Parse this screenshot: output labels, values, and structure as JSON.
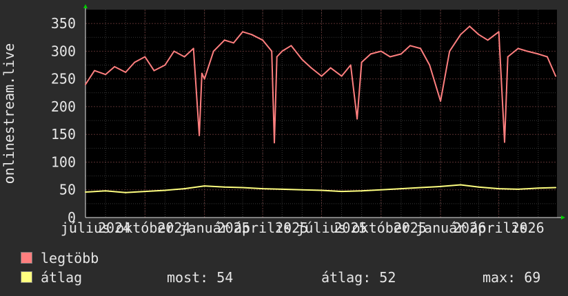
{
  "chart_data": {
    "type": "line",
    "ylabel": "onlinestream.live",
    "ylim": [
      0,
      375
    ],
    "yticks": [
      0,
      50,
      100,
      150,
      200,
      250,
      300,
      350
    ],
    "xlim": [
      "2024-07-01",
      "2026-06-30"
    ],
    "xticks": [
      {
        "month": "július",
        "year": "2024"
      },
      {
        "month": "október",
        "year": "2024"
      },
      {
        "month": "január",
        "year": "2025"
      },
      {
        "month": "április",
        "year": "2025"
      },
      {
        "month": "július",
        "year": "2025"
      },
      {
        "month": "október",
        "year": "2025"
      },
      {
        "month": "január",
        "year": "2026"
      },
      {
        "month": "április",
        "year": "2026"
      }
    ],
    "grid": true,
    "legend_placement": "bottom",
    "series": [
      {
        "name": "legtöbb",
        "color": "#ff7f7f",
        "x": [
          "2024-07-01",
          "2024-07-15",
          "2024-08-01",
          "2024-08-15",
          "2024-09-01",
          "2024-09-15",
          "2024-10-01",
          "2024-10-15",
          "2024-11-01",
          "2024-11-15",
          "2024-12-01",
          "2024-12-15",
          "2024-12-24",
          "2024-12-28",
          "2025-01-01",
          "2025-01-15",
          "2025-02-01",
          "2025-02-15",
          "2025-03-01",
          "2025-03-15",
          "2025-04-01",
          "2025-04-15",
          "2025-04-19",
          "2025-04-23",
          "2025-05-01",
          "2025-05-15",
          "2025-06-01",
          "2025-06-15",
          "2025-07-01",
          "2025-07-15",
          "2025-08-01",
          "2025-08-15",
          "2025-08-25",
          "2025-09-01",
          "2025-09-15",
          "2025-10-01",
          "2025-10-15",
          "2025-11-01",
          "2025-11-15",
          "2025-12-01",
          "2025-12-15",
          "2026-01-01",
          "2026-01-15",
          "2026-02-01",
          "2026-02-15",
          "2026-03-01",
          "2026-03-15",
          "2026-04-01",
          "2026-04-10",
          "2026-04-15",
          "2026-05-01",
          "2026-05-15",
          "2026-06-01",
          "2026-06-15",
          "2026-06-28"
        ],
        "values": [
          240,
          265,
          258,
          272,
          262,
          280,
          290,
          265,
          275,
          300,
          290,
          305,
          148,
          260,
          250,
          300,
          320,
          315,
          335,
          330,
          320,
          300,
          135,
          290,
          300,
          310,
          285,
          270,
          255,
          270,
          255,
          275,
          178,
          280,
          295,
          300,
          290,
          295,
          310,
          305,
          275,
          210,
          300,
          330,
          345,
          330,
          320,
          335,
          136,
          290,
          305,
          300,
          295,
          290,
          255
        ]
      },
      {
        "name": "átlag",
        "color": "#ffff80",
        "x": [
          "2024-07-01",
          "2024-08-01",
          "2024-09-01",
          "2024-10-01",
          "2024-11-01",
          "2024-12-01",
          "2025-01-01",
          "2025-02-01",
          "2025-03-01",
          "2025-04-01",
          "2025-05-01",
          "2025-06-01",
          "2025-07-01",
          "2025-08-01",
          "2025-09-01",
          "2025-10-01",
          "2025-11-01",
          "2025-12-01",
          "2026-01-01",
          "2026-02-01",
          "2026-03-01",
          "2026-04-01",
          "2026-05-01",
          "2026-06-01",
          "2026-06-28"
        ],
        "values": [
          46,
          48,
          45,
          47,
          49,
          52,
          57,
          55,
          54,
          52,
          51,
          50,
          49,
          47,
          48,
          50,
          52,
          54,
          56,
          59,
          55,
          52,
          51,
          53,
          54
        ]
      }
    ]
  },
  "legend": {
    "items": [
      {
        "label": "legtöbb",
        "color": "#ff7f7f"
      },
      {
        "label": "átlag",
        "color": "#ffff80"
      }
    ],
    "now_label": "most: 54",
    "avg_label": "átlag: 52",
    "max_label": "max: 69"
  }
}
